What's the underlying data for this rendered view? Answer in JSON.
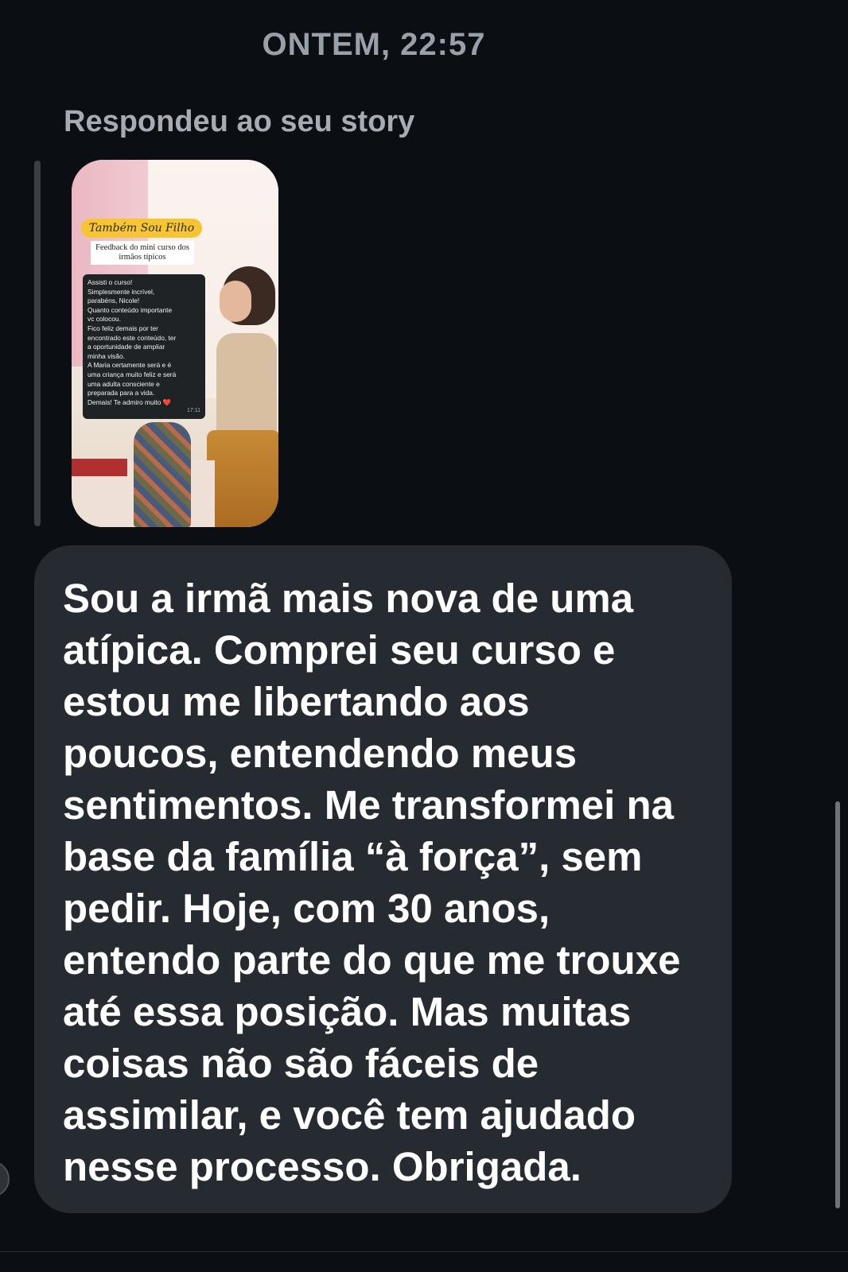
{
  "conversation": {
    "timestamp": "ONTEM, 22:57",
    "reply_label": "Respondeu ao seu story"
  },
  "story": {
    "title_pill": "Também Sou Filho",
    "subtitle": "Feedback do mini curso dos irmãos típicos",
    "chat_lines": [
      "Assisti o curso!",
      "Simplesmente incrível,",
      "parabéns, Nicole!",
      "Quanto conteúdo importante",
      "vc colocou.",
      "Fico feliz demais por ter",
      "encontrado este conteúdo, ter",
      "a oportunidade de ampliar",
      "minha visão.",
      "A Maria certamente será e é",
      "uma criança muito feliz e será",
      "uma adulta consciente e",
      "preparada para a vida.",
      "Demais! Te admiro muito ❤️"
    ],
    "chat_time": "17:11"
  },
  "message": {
    "lines": [
      "Sou a irmã mais nova de uma",
      "atípica. Comprei seu curso e",
      "estou me libertando aos",
      "poucos, entendendo meus",
      "sentimentos. Me transformei na",
      "base da família “à força”, sem",
      "pedir. Hoje, com 30 anos,",
      "entendo parte do que me trouxe",
      "até essa posição. Mas muitas",
      "coisas não são fáceis de",
      "assimilar, e você tem ajudado",
      "nesse processo. Obrigada."
    ]
  },
  "colors": {
    "background": "#0b0e13",
    "bubble": "#262a31",
    "meta_text": "#9aa0a9",
    "message_text": "#ffffff"
  }
}
